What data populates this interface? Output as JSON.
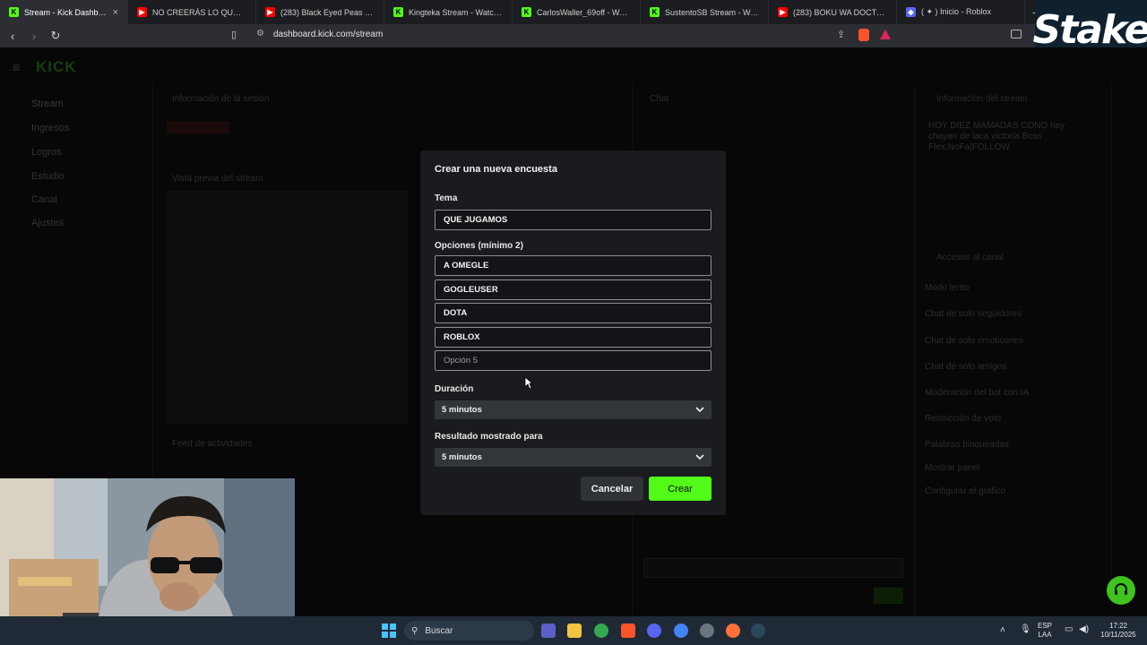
{
  "browser": {
    "tabs": [
      {
        "title": "Stream - Kick Dashboard",
        "icon": "kick",
        "active": true
      },
      {
        "title": "NO CREERÁS LO QUE PASÓ EN",
        "icon": "yt"
      },
      {
        "title": "(283) Black Eyed Peas - I Gotta",
        "icon": "yt"
      },
      {
        "title": "Kingteka Stream - Watch L",
        "icon": "kick"
      },
      {
        "title": "CarlosWaller_69off - Watch the",
        "icon": "kick"
      },
      {
        "title": "SustentoSB Stream - Watch",
        "icon": "kick"
      },
      {
        "title": "(283) BOKU WA DOCTOR - You",
        "icon": "yt"
      },
      {
        "title": "( ✦ ) Inicio - Roblox",
        "icon": "rb"
      }
    ],
    "close_glyph": "×",
    "new_tab_glyph": "+",
    "url": "dashboard.kick.com/stream",
    "brand_color": "#53fc18"
  },
  "overlay": {
    "stake_logo": "Stake"
  },
  "dashboard": {
    "logo": "KICK",
    "nav": [
      "Stream",
      "Ingresos",
      "Logros",
      "Estudio",
      "Canal",
      "Ajustes"
    ],
    "session_title": "Información de la sesión",
    "preview_title": "Vista previa del stream",
    "feed_title": "Feed de actividades",
    "chat_title": "Chat",
    "stream_info_title": "Información del stream",
    "stream_info_text": "HOY DIEZ MAMADAS CONO hay chayan de laca victoria Boss Flex.NoFa|FOLLOW",
    "quick_access": "Accesos al canal",
    "quick_items": [
      "Modo lento",
      "Chat de solo seguidores",
      "Chat de solo emoticones",
      "Chat de solo amigos",
      "Moderación del bot con IA",
      "Restricción de voto",
      "Palabras bloqueadas",
      "Mostrar panel",
      "Configurar el gráfico"
    ]
  },
  "poll_modal": {
    "title": "Crear una nueva encuesta",
    "topic_label": "Tema",
    "topic_value": "QUE JUGAMOS",
    "options_label": "Opciones (mínimo 2)",
    "options": [
      "A OMEGLE",
      "GOGLEUSER",
      "DOTA",
      "ROBLOX"
    ],
    "option_placeholder": "Opción 5",
    "duration_label": "Duración",
    "duration_value": "5 minutos",
    "result_label": "Resultado mostrado para",
    "result_value": "5 minutos",
    "cancel_label": "Cancelar",
    "create_label": "Crear"
  },
  "taskbar": {
    "search_placeholder": "Buscar",
    "lang_top": "ESP",
    "lang_bottom": "LAA",
    "time": "17:22",
    "date": "10/11/2025"
  }
}
